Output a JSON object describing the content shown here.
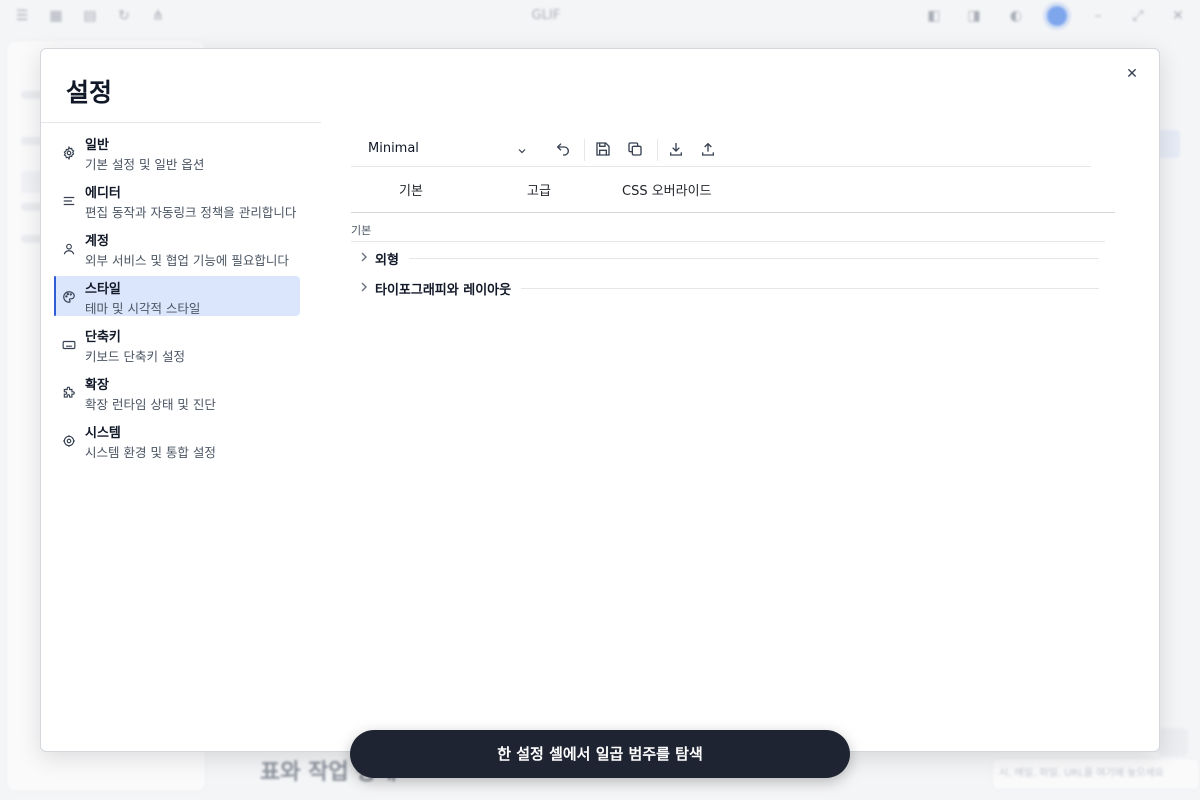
{
  "app": {
    "window_title": "GLIF",
    "background_heading": "표와 작업 상태",
    "background_search_placeholder": "시, 메일, 파일, URL을 여기에 놓으세요"
  },
  "settings": {
    "title": "설정",
    "close_symbol": "✕",
    "nav": [
      {
        "label": "일반",
        "desc": "기본 설정 및 일반 옵션",
        "icon": "gear-icon",
        "active": false
      },
      {
        "label": "에디터",
        "desc": "편집 동작과 자동링크 정책을 관리합니다",
        "icon": "text-lines-icon",
        "active": false
      },
      {
        "label": "계정",
        "desc": "외부 서비스 및 협업 기능에 필요합니다",
        "icon": "user-icon",
        "active": false
      },
      {
        "label": "스타일",
        "desc": "테마 및 시각적 스타일",
        "icon": "palette-icon",
        "active": true
      },
      {
        "label": "단축키",
        "desc": "키보드 단축키 설정",
        "icon": "keyboard-icon",
        "active": false
      },
      {
        "label": "확장",
        "desc": "확장 런타임 상태 및 진단",
        "icon": "puzzle-icon",
        "active": false
      },
      {
        "label": "시스템",
        "desc": "시스템 환경 및 통합 설정",
        "icon": "system-gear-icon",
        "active": false
      }
    ],
    "toolbar": {
      "preset_value": "Minimal"
    },
    "tabs": [
      "기본",
      "고급",
      "CSS 오버라이드"
    ],
    "section_label": "기본",
    "accordions": [
      "외형",
      "타이포그래피와 레이아웃"
    ]
  },
  "toast": {
    "message": "한 설정 셀에서 일곱 범주를 탐색"
  },
  "colors": {
    "accent": "#2f5bd3",
    "active_bg": "#dbe5fb",
    "toast_bg": "#1f2433",
    "avatar": "#1d66e5"
  }
}
